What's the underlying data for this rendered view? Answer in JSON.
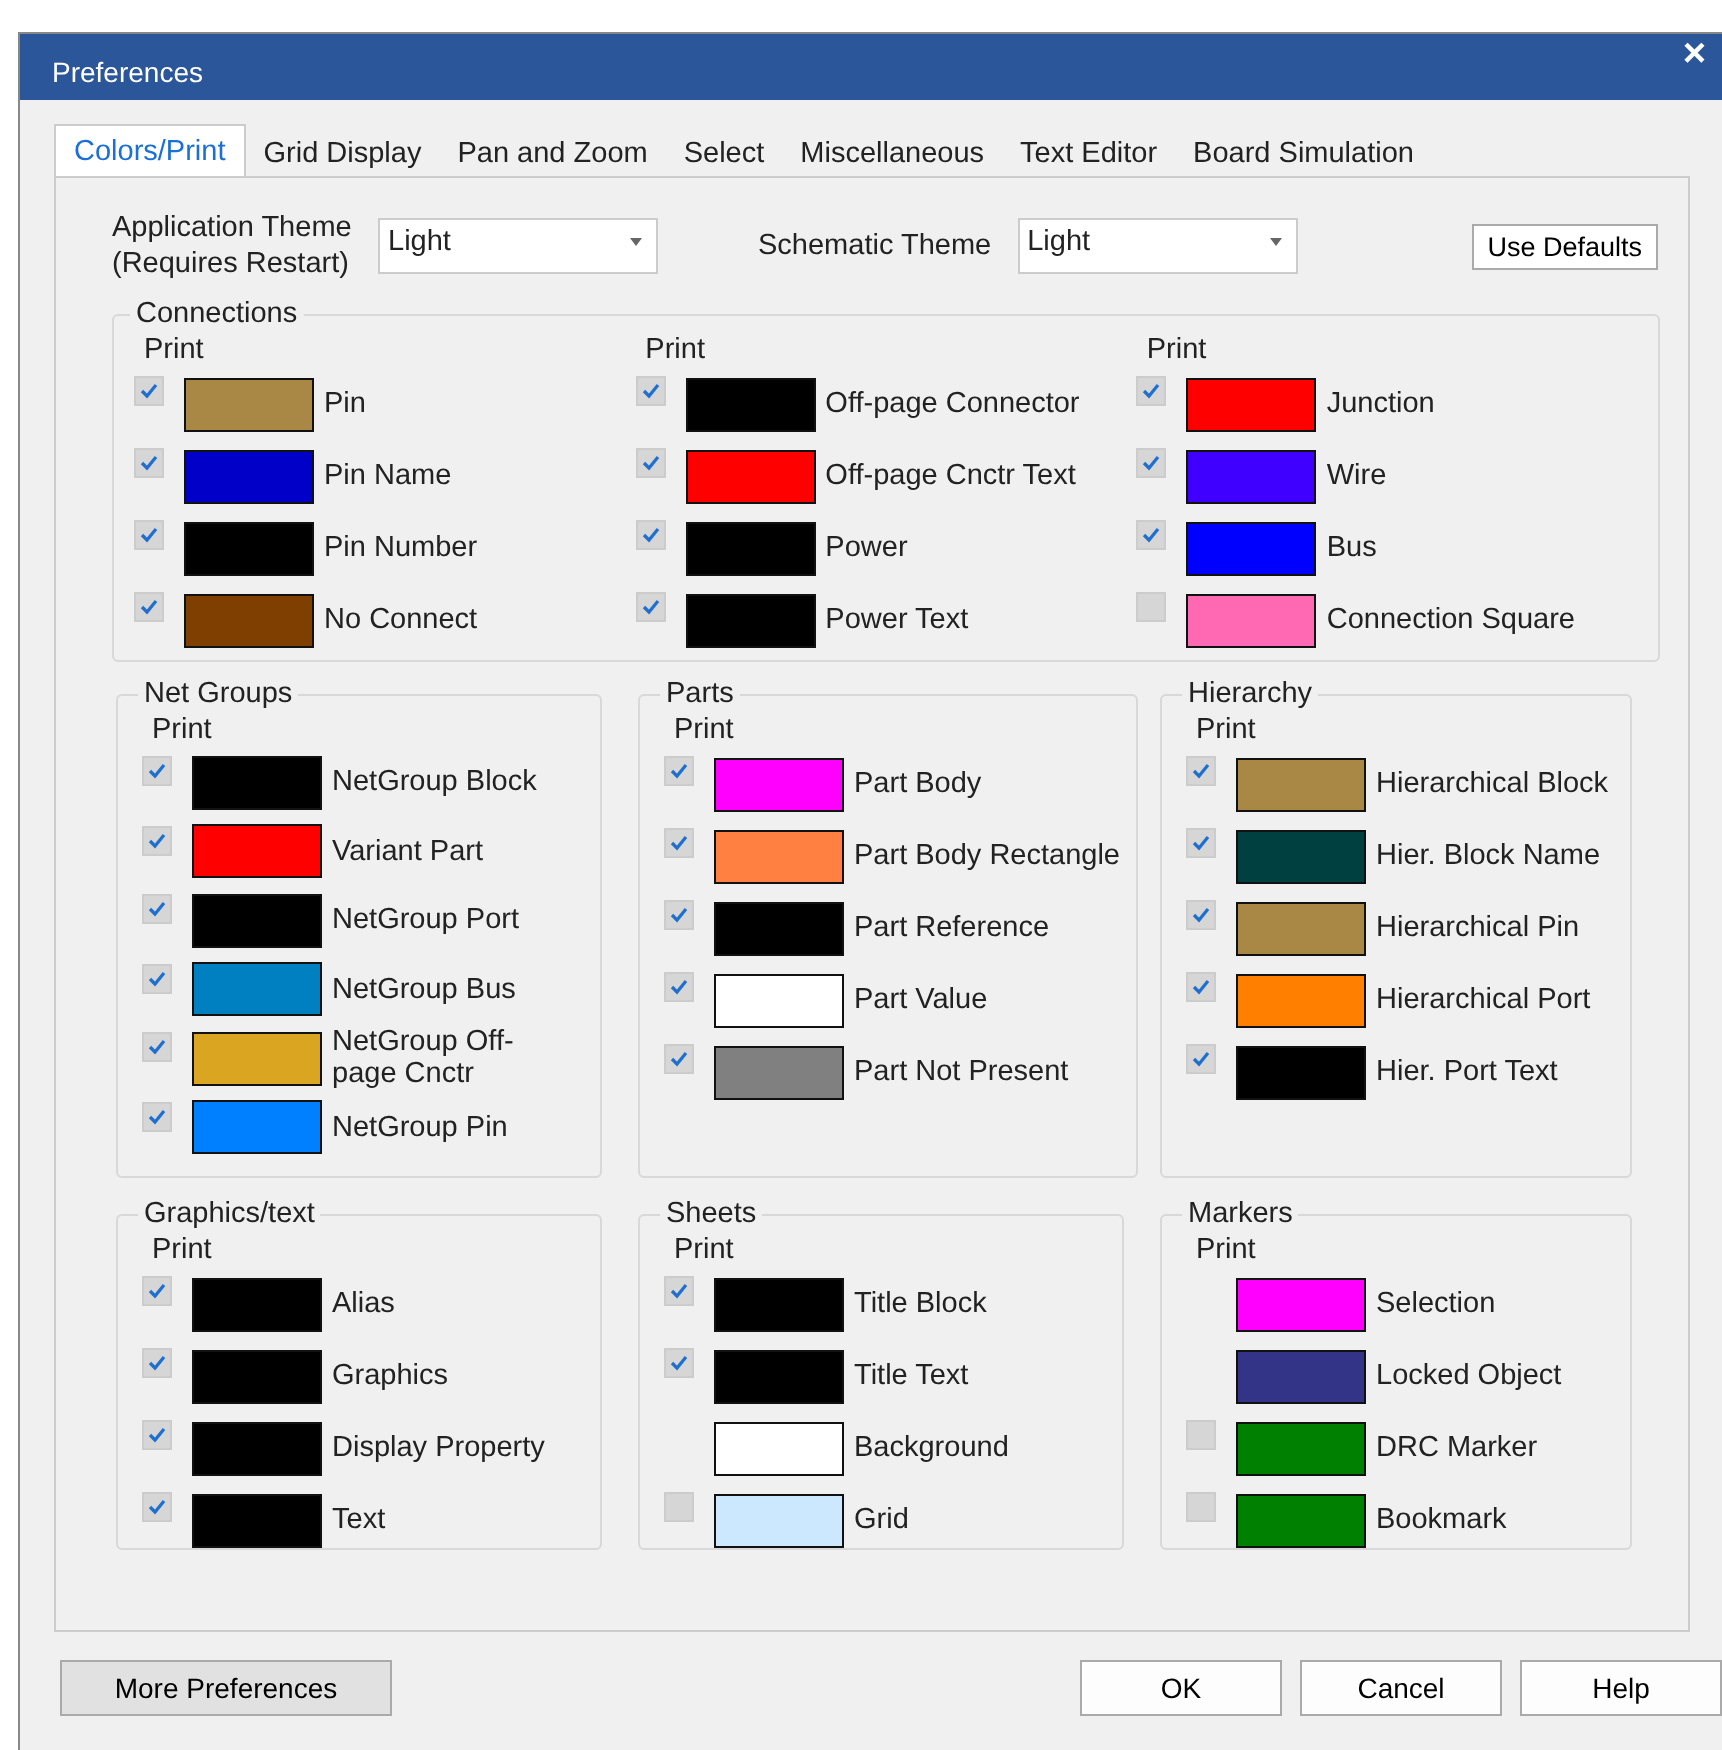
{
  "window": {
    "title": "Preferences",
    "close": "×"
  },
  "tabs": [
    {
      "label": "Colors/Print",
      "selected": true
    },
    {
      "label": "Grid Display",
      "selected": false
    },
    {
      "label": "Pan and Zoom",
      "selected": false
    },
    {
      "label": "Select",
      "selected": false
    },
    {
      "label": "Miscellaneous",
      "selected": false
    },
    {
      "label": "Text Editor",
      "selected": false
    },
    {
      "label": "Board Simulation",
      "selected": false
    }
  ],
  "themes": [
    {
      "label": "Application Theme (Requires Restart)",
      "value": "Light"
    },
    {
      "label": "Schematic Theme",
      "value": "Light"
    }
  ],
  "use_defaults": "Use Defaults",
  "connections": {
    "title": "Connections",
    "columns": [
      {
        "print_label": "Print",
        "items": [
          {
            "kind": "checkbox",
            "checked": true,
            "color": "#a88844",
            "label": "Pin"
          },
          {
            "kind": "checkbox",
            "checked": true,
            "color": "#0000c8",
            "label": "Pin Name"
          },
          {
            "kind": "checkbox",
            "checked": true,
            "color": "#000000",
            "label": "Pin Number"
          },
          {
            "kind": "checkbox",
            "checked": true,
            "color": "#7f3f00",
            "label": "No Connect"
          }
        ]
      },
      {
        "print_label": "Print",
        "items": [
          {
            "kind": "checkbox",
            "checked": true,
            "color": "#000000",
            "label": "Off-page Connector"
          },
          {
            "kind": "checkbox",
            "checked": true,
            "color": "#ff0000",
            "label": "Off-page Cnctr Text"
          },
          {
            "kind": "checkbox",
            "checked": true,
            "color": "#000000",
            "label": "Power"
          },
          {
            "kind": "checkbox",
            "checked": true,
            "color": "#000000",
            "label": "Power Text"
          }
        ]
      },
      {
        "print_label": "Print",
        "items": [
          {
            "kind": "checkbox",
            "checked": true,
            "color": "#ff0000",
            "label": "Junction"
          },
          {
            "kind": "checkbox",
            "checked": true,
            "color": "#4000ff",
            "label": "Wire"
          },
          {
            "kind": "checkbox",
            "checked": true,
            "color": "#0000ff",
            "label": "Bus"
          },
          {
            "kind": "checkbox",
            "checked": false,
            "color": "#ff69b4",
            "label": "Connection Square"
          }
        ]
      }
    ]
  },
  "groups": [
    {
      "title": "Net Groups",
      "print_label": "Print",
      "items": [
        {
          "kind": "checkbox",
          "checked": true,
          "color": "#000000",
          "label": "NetGroup Block"
        },
        {
          "kind": "checkbox",
          "checked": true,
          "color": "#ff0000",
          "label": "Variant Part"
        },
        {
          "kind": "checkbox",
          "checked": true,
          "color": "#000000",
          "label": "NetGroup Port"
        },
        {
          "kind": "checkbox",
          "checked": true,
          "color": "#0080c0",
          "label": "NetGroup Bus"
        },
        {
          "kind": "checkbox",
          "checked": true,
          "color": "#daa520",
          "label": "NetGroup Off-page Cnctr"
        },
        {
          "kind": "checkbox",
          "checked": true,
          "color": "#0080ff",
          "label": "NetGroup Pin"
        }
      ]
    },
    {
      "title": "Parts",
      "print_label": "Print",
      "items": [
        {
          "kind": "checkbox",
          "checked": true,
          "color": "#ff00ff",
          "label": "Part Body"
        },
        {
          "kind": "checkbox",
          "checked": true,
          "color": "#ff8040",
          "label": "Part Body Rectangle"
        },
        {
          "kind": "checkbox",
          "checked": true,
          "color": "#000000",
          "label": "Part Reference"
        },
        {
          "kind": "checkbox",
          "checked": true,
          "color": "#ffffff",
          "label": "Part Value"
        },
        {
          "kind": "checkbox",
          "checked": true,
          "color": "#808080",
          "label": "Part Not Present"
        }
      ]
    },
    {
      "title": "Hierarchy",
      "print_label": "Print",
      "items": [
        {
          "kind": "checkbox",
          "checked": true,
          "color": "#a88844",
          "label": "Hierarchical Block"
        },
        {
          "kind": "checkbox",
          "checked": true,
          "color": "#004040",
          "label": "Hier. Block Name"
        },
        {
          "kind": "checkbox",
          "checked": true,
          "color": "#a88844",
          "label": "Hierarchical Pin"
        },
        {
          "kind": "checkbox",
          "checked": true,
          "color": "#ff8000",
          "label": "Hierarchical Port"
        },
        {
          "kind": "checkbox",
          "checked": true,
          "color": "#000000",
          "label": "Hier. Port Text"
        }
      ]
    },
    {
      "title": "Graphics/text",
      "print_label": "Print",
      "items": [
        {
          "kind": "checkbox",
          "checked": true,
          "color": "#000000",
          "label": "Alias"
        },
        {
          "kind": "checkbox",
          "checked": true,
          "color": "#000000",
          "label": "Graphics"
        },
        {
          "kind": "checkbox",
          "checked": true,
          "color": "#000000",
          "label": "Display Property"
        },
        {
          "kind": "checkbox",
          "checked": true,
          "color": "#000000",
          "label": "Text"
        }
      ]
    },
    {
      "title": "Sheets",
      "print_label": "Print",
      "items": [
        {
          "kind": "checkbox",
          "checked": true,
          "color": "#000000",
          "label": "Title Block"
        },
        {
          "kind": "checkbox",
          "checked": true,
          "color": "#000000",
          "label": "Title Text"
        },
        {
          "kind": "plain",
          "color": "#ffffff",
          "label": "Background"
        },
        {
          "kind": "checkbox",
          "checked": false,
          "color": "#cce8ff",
          "label": "Grid"
        }
      ]
    },
    {
      "title": "Markers",
      "print_label": "Print",
      "items": [
        {
          "kind": "plain",
          "color": "#ff00ff",
          "label": "Selection"
        },
        {
          "kind": "plain",
          "color": "#333388",
          "label": "Locked Object"
        },
        {
          "kind": "checkbox",
          "checked": false,
          "color": "#008000",
          "label": "DRC Marker"
        },
        {
          "kind": "checkbox",
          "checked": false,
          "color": "#008000",
          "label": "Bookmark"
        }
      ]
    }
  ],
  "buttons": {
    "more": "More Preferences",
    "ok": "OK",
    "cancel": "Cancel",
    "help": "Help"
  }
}
